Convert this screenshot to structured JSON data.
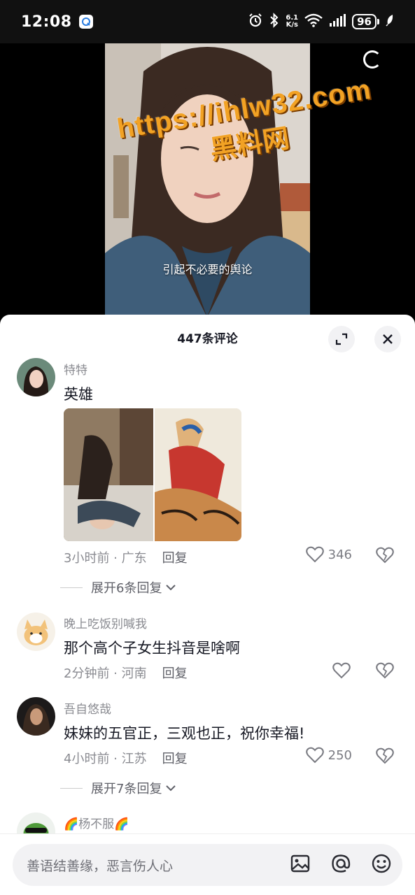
{
  "status_bar": {
    "time": "12:08",
    "net_speed_value": "6.1",
    "net_speed_unit": "K/s",
    "battery": "96"
  },
  "video": {
    "subtitle": "引起不必要的舆论",
    "watermark_url": "https://ihlw32.com",
    "watermark_name": "黑料网"
  },
  "comments_sheet": {
    "title": "447条评论",
    "comments": [
      {
        "username": "特特",
        "text": "英雄",
        "time": "3小时前",
        "location": "广东",
        "reply_label": "回复",
        "likes": "346",
        "expand_label": "展开6条回复"
      },
      {
        "username": "晚上吃饭别喊我",
        "text": "那个高个子女生抖音是啥啊",
        "time": "2分钟前",
        "location": "河南",
        "reply_label": "回复"
      },
      {
        "username": "吾自悠哉",
        "text": "妹妹的五官正，三观也正，祝你幸福!",
        "time": "4小时前",
        "location": "江苏",
        "reply_label": "回复",
        "likes": "250",
        "expand_label": "展开7条回复"
      },
      {
        "username": "🌈杨不服🌈"
      }
    ],
    "input_placeholder": "善语结善缘，恶言伤人心"
  },
  "icons": {
    "alarm": "alarm-icon",
    "bluetooth": "bluetooth-icon",
    "wifi": "wifi-icon",
    "signal": "signal-icon",
    "expand": "expand-icon",
    "close": "close-icon",
    "heart": "heart-icon",
    "dislike": "broken-heart-icon",
    "image": "image-icon",
    "at": "at-icon",
    "emoji": "emoji-icon"
  },
  "colors": {
    "watermark": "#f2a224",
    "text_primary": "#161823",
    "text_secondary": "#8a8b91",
    "sheet_bg": "#ffffff"
  }
}
